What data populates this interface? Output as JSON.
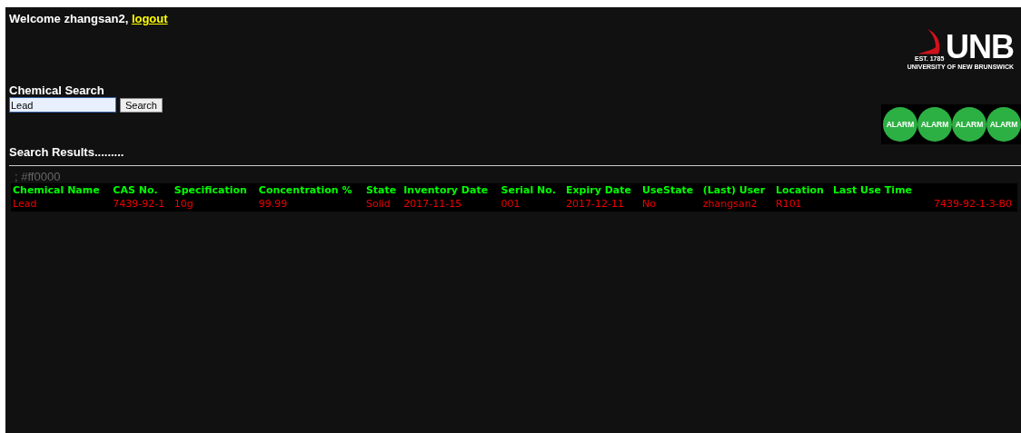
{
  "header": {
    "welcome": "Welcome zhangsan2,",
    "logout": "logout"
  },
  "logo": {
    "est": "EST. 1785",
    "name": "UNB",
    "subtitle": "UNIVERSITY OF NEW BRUNSWICK"
  },
  "search": {
    "title": "Chemical Search",
    "value": "Lead",
    "button": "Search"
  },
  "alarms": [
    "ALARM",
    "ALARM",
    "ALARM",
    "ALARM"
  ],
  "results": {
    "title": "Search Results.........",
    "note": "; #ff0000"
  },
  "table": {
    "columns": [
      "Chemical Name",
      "CAS No.",
      "Specification",
      "Concentration %",
      "State",
      "Inventory Date",
      "Serial No.",
      "Expiry Date",
      "UseState",
      "(Last) User",
      "Location",
      "Last Use Time"
    ],
    "rows": [
      {
        "cells": [
          "Lead",
          "7439-92-1",
          "10g",
          "99.99",
          "Solid",
          "2017-11-15",
          "001",
          "2017-12-11",
          "No",
          "zhangsan2",
          "R101",
          "",
          "7439-92-1-3-B0"
        ]
      }
    ]
  }
}
